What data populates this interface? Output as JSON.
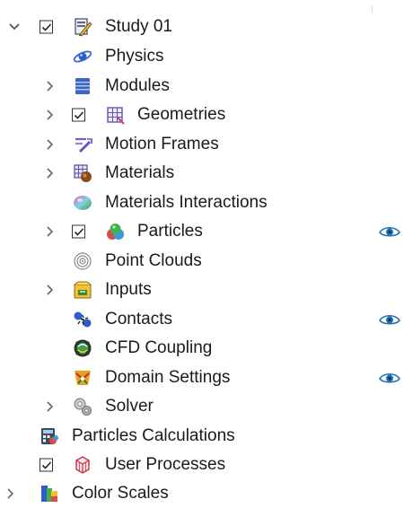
{
  "tree": {
    "study": {
      "label": "Study 01",
      "checked": true,
      "expanded": true
    },
    "items": [
      {
        "label": "Physics"
      },
      {
        "label": "Modules"
      },
      {
        "label": "Geometries",
        "checked": true
      },
      {
        "label": "Motion Frames"
      },
      {
        "label": "Materials"
      },
      {
        "label": "Materials Interactions"
      },
      {
        "label": "Particles",
        "checked": true
      },
      {
        "label": "Point Clouds"
      },
      {
        "label": "Inputs"
      },
      {
        "label": "Contacts"
      },
      {
        "label": "CFD Coupling"
      },
      {
        "label": "Domain Settings"
      },
      {
        "label": "Solver"
      }
    ],
    "roots": [
      {
        "label": "Particles Calculations"
      },
      {
        "label": "User Processes",
        "checked": true
      },
      {
        "label": "Color Scales"
      }
    ]
  },
  "colors": {
    "eye": "#1f6fb5",
    "chevron": "#555555",
    "check": "#222222"
  }
}
